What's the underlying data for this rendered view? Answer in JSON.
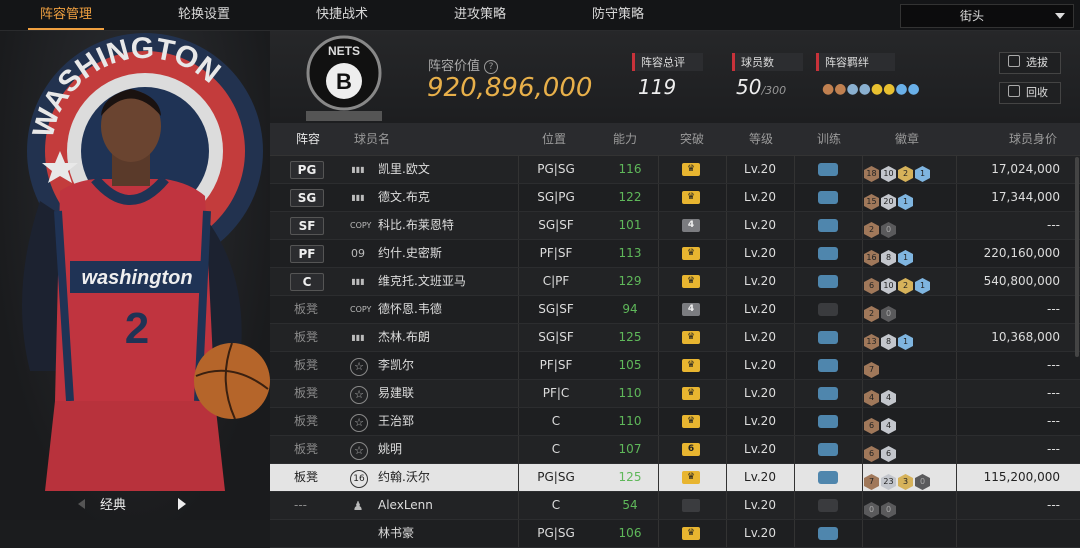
{
  "tabs": [
    {
      "label": "阵容管理",
      "active": true
    },
    {
      "label": "轮换设置"
    },
    {
      "label": "快捷战术"
    },
    {
      "label": "进攻策略"
    },
    {
      "label": "防守策略"
    }
  ],
  "dropdown": {
    "value": "街头"
  },
  "left_panel": {
    "team_logo_text": "WASHINGTON",
    "jersey_text": "washington",
    "jersey_number": "2",
    "nav_label": "经典"
  },
  "header": {
    "logo_text": "NETS",
    "value_label": "阵容价值",
    "value": "920,896,000",
    "rating_label": "阵容总评",
    "rating": "119",
    "players_label": "球员数",
    "players_count": "50",
    "players_max": "/300",
    "bond_label": "阵容羁绊",
    "select_button": "选拔",
    "recycle_button": "回收"
  },
  "columns": [
    "阵容",
    "球员名",
    "位置",
    "能力",
    "突破",
    "等级",
    "训练",
    "徽章",
    "球员身价"
  ],
  "rows": [
    {
      "slot": "PG",
      "type": "bar",
      "name": "凯里.欧文",
      "pos": "PG|SG",
      "ability": "116",
      "brk": "gold",
      "level": "Lv.20",
      "badges": [
        [
          "b",
          "18"
        ],
        [
          "s",
          "10"
        ],
        [
          "g",
          "2"
        ],
        [
          "p",
          "1"
        ]
      ],
      "price": "17,024,000"
    },
    {
      "slot": "SG",
      "type": "bar",
      "name": "德文.布克",
      "pos": "SG|PG",
      "ability": "122",
      "brk": "gold",
      "level": "Lv.20",
      "badges": [
        [
          "b",
          "15"
        ],
        [
          "s",
          "20"
        ],
        [
          "p",
          "1"
        ]
      ],
      "price": "17,344,000"
    },
    {
      "slot": "SF",
      "type": "COPY",
      "name": "科比.布莱恩特",
      "pos": "SG|SF",
      "ability": "101",
      "brk": "gray4",
      "level": "Lv.20",
      "badges": [
        [
          "b",
          "2"
        ],
        [
          "e",
          "0"
        ]
      ],
      "price": "---"
    },
    {
      "slot": "PF",
      "type": "09",
      "name": "约什.史密斯",
      "pos": "PF|SF",
      "ability": "113",
      "brk": "gold",
      "level": "Lv.20",
      "badges": [
        [
          "b",
          "16"
        ],
        [
          "s",
          "8"
        ],
        [
          "p",
          "1"
        ]
      ],
      "price": "220,160,000"
    },
    {
      "slot": "C",
      "type": "bar",
      "name": "维克托.文班亚马",
      "pos": "C|PF",
      "ability": "129",
      "brk": "gold",
      "level": "Lv.20",
      "badges": [
        [
          "b",
          "6"
        ],
        [
          "s",
          "10"
        ],
        [
          "g",
          "2"
        ],
        [
          "p",
          "1"
        ]
      ],
      "price": "540,800,000"
    },
    {
      "slot": "板凳",
      "type": "COPY",
      "name": "德怀恩.韦德",
      "pos": "SG|SF",
      "ability": "94",
      "brk": "gray4",
      "level": "Lv.20",
      "train": "dark",
      "badges": [
        [
          "b",
          "2"
        ],
        [
          "e",
          "0"
        ]
      ],
      "price": "---"
    },
    {
      "slot": "板凳",
      "type": "bar",
      "name": "杰林.布朗",
      "pos": "SG|SF",
      "ability": "125",
      "brk": "gold",
      "level": "Lv.20",
      "badges": [
        [
          "b",
          "13"
        ],
        [
          "s",
          "8"
        ],
        [
          "p",
          "1"
        ]
      ],
      "price": "10,368,000"
    },
    {
      "slot": "板凳",
      "type": "star",
      "name": "李凯尔",
      "pos": "PF|SF",
      "ability": "105",
      "brk": "gold",
      "level": "Lv.20",
      "badges": [
        [
          "b",
          "7"
        ]
      ],
      "price": "---"
    },
    {
      "slot": "板凳",
      "type": "star",
      "name": "易建联",
      "pos": "PF|C",
      "ability": "110",
      "brk": "gold",
      "level": "Lv.20",
      "badges": [
        [
          "b",
          "4"
        ],
        [
          "s",
          "4"
        ]
      ],
      "price": "---"
    },
    {
      "slot": "板凳",
      "type": "star",
      "name": "王治郅",
      "pos": "C",
      "ability": "110",
      "brk": "gold",
      "level": "Lv.20",
      "badges": [
        [
          "b",
          "6"
        ],
        [
          "s",
          "4"
        ]
      ],
      "price": "---"
    },
    {
      "slot": "板凳",
      "type": "star",
      "name": "姚明",
      "pos": "C",
      "ability": "107",
      "brk": "gold6",
      "level": "Lv.20",
      "badges": [
        [
          "b",
          "6"
        ],
        [
          "s",
          "6"
        ]
      ],
      "price": "---"
    },
    {
      "slot": "板凳",
      "type": "16",
      "name": "约翰.沃尔",
      "pos": "PG|SG",
      "ability": "125",
      "brk": "gold",
      "level": "Lv.20",
      "hl": true,
      "badges": [
        [
          "b",
          "7"
        ],
        [
          "s",
          "23"
        ],
        [
          "g",
          "3"
        ],
        [
          "e",
          "0"
        ]
      ],
      "price": "115,200,000"
    },
    {
      "slot": "---",
      "type": "person",
      "name": "AlexLenn",
      "pos": "C",
      "ability": "54",
      "brk": "dark",
      "level": "Lv.20",
      "train": "dark",
      "badges": [
        [
          "e",
          "0"
        ],
        [
          "e",
          "0"
        ]
      ],
      "price": "---"
    },
    {
      "slot": "",
      "type": "",
      "name": "林书豪",
      "pos": "PG|SG",
      "ability": "106",
      "brk": "gold",
      "level": "Lv.20",
      "badges": [],
      "price": ""
    }
  ]
}
